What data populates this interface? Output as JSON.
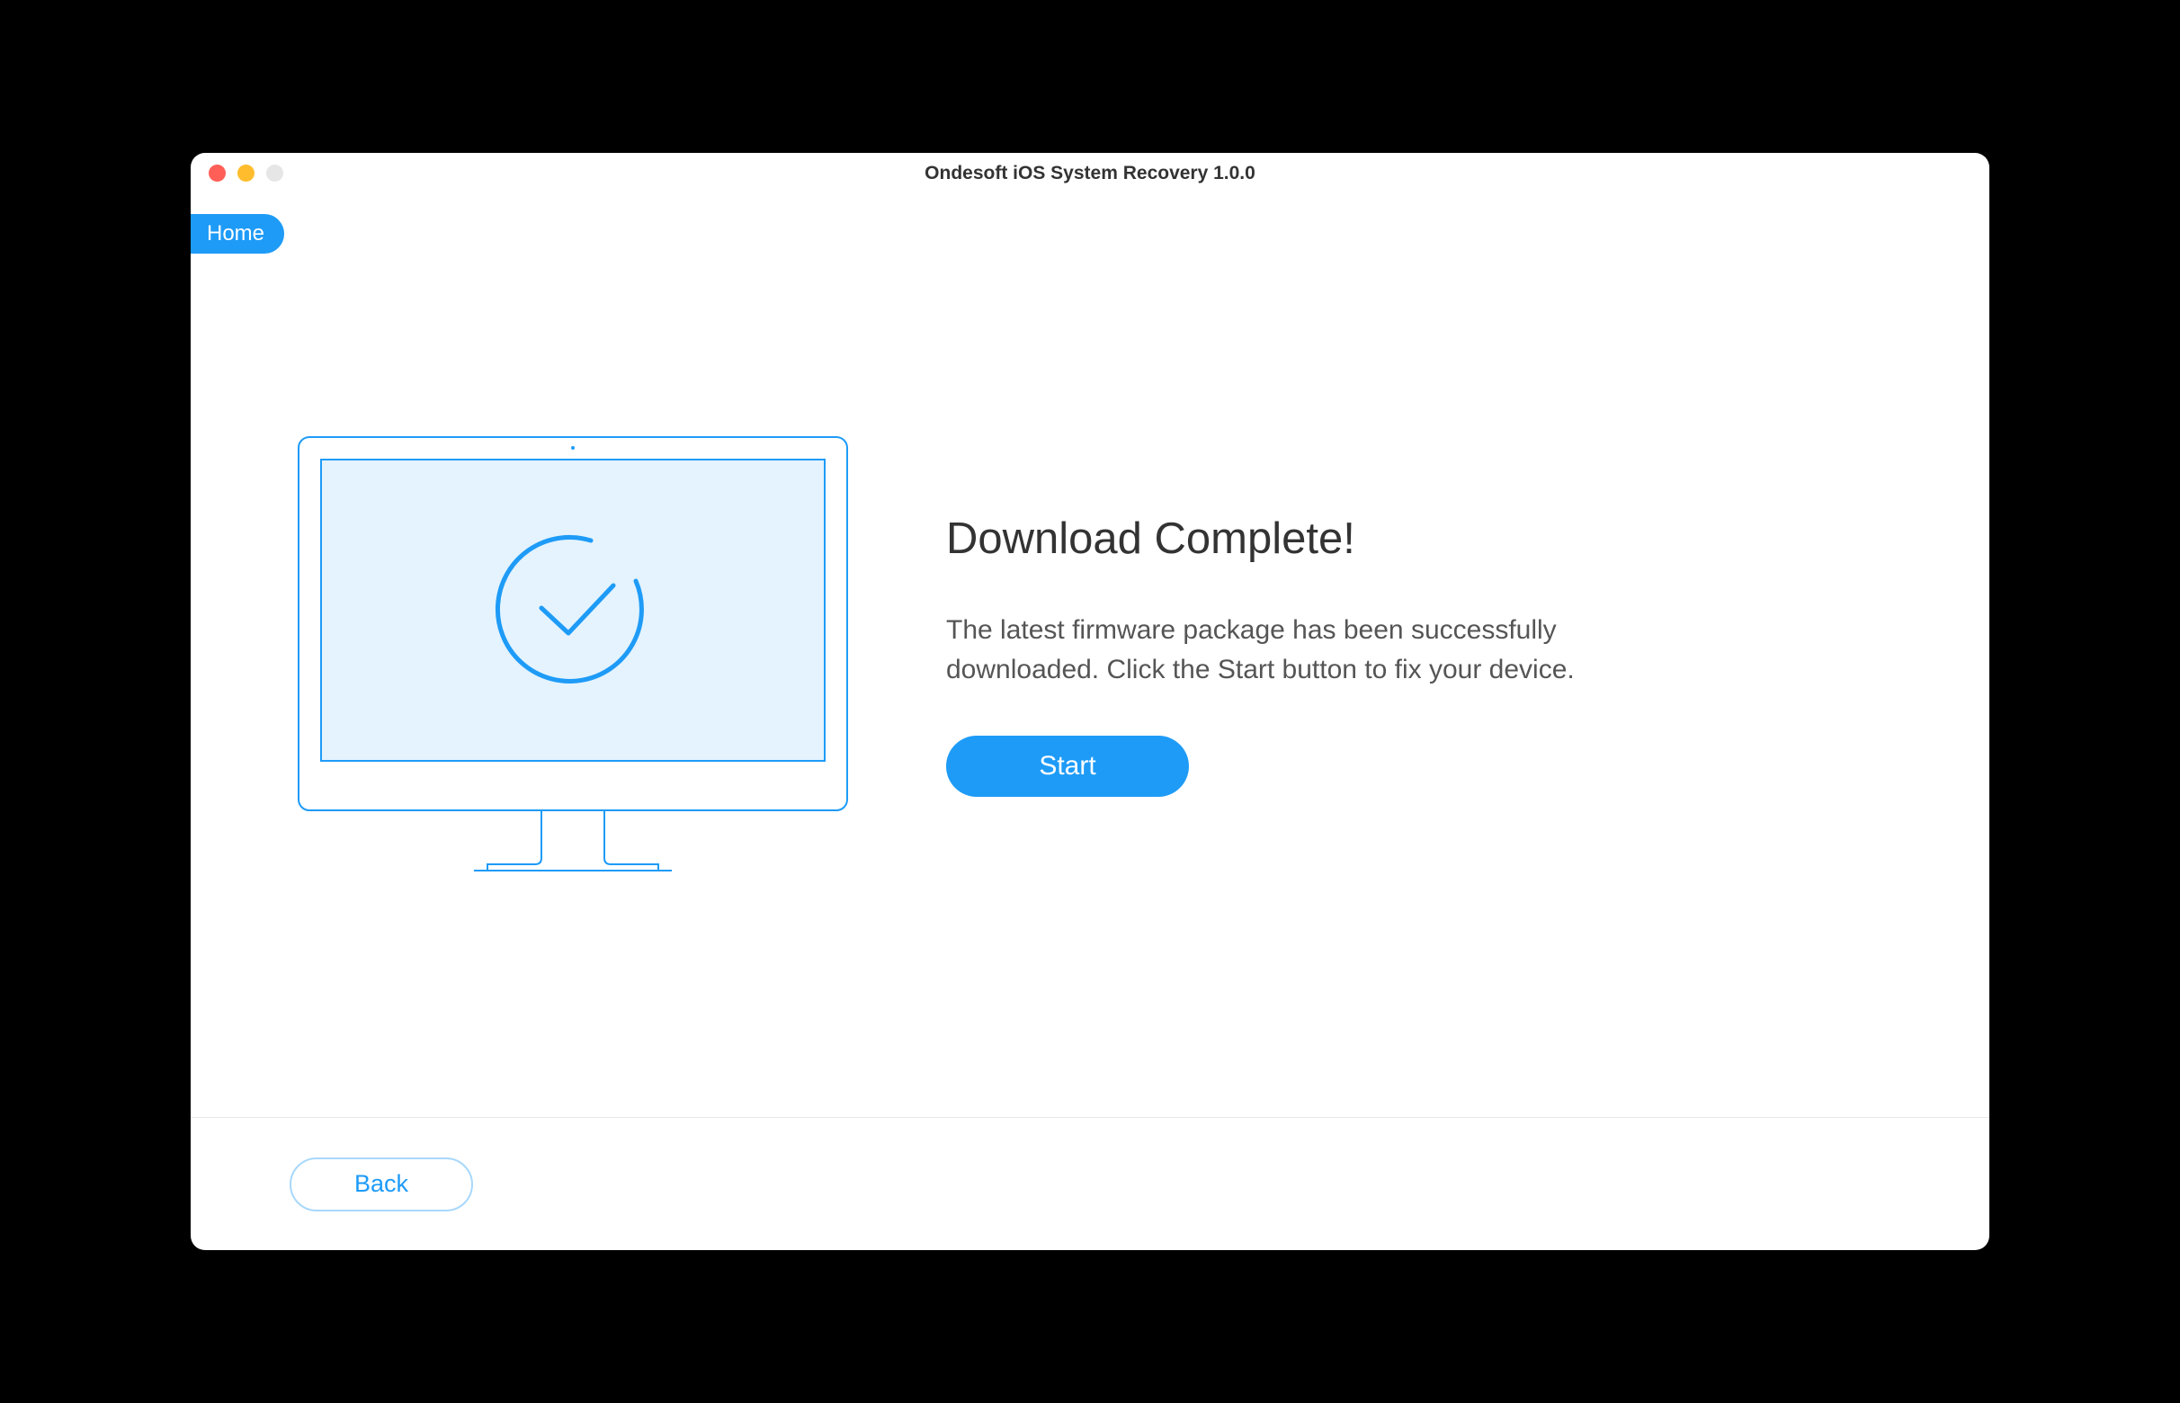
{
  "window": {
    "title": "Ondesoft iOS System Recovery 1.0.0"
  },
  "nav": {
    "home_label": "Home"
  },
  "main": {
    "heading": "Download Complete!",
    "description": "The latest firmware package has been successfully downloaded. Click the Start button to fix your device.",
    "start_label": "Start"
  },
  "footer": {
    "back_label": "Back"
  }
}
